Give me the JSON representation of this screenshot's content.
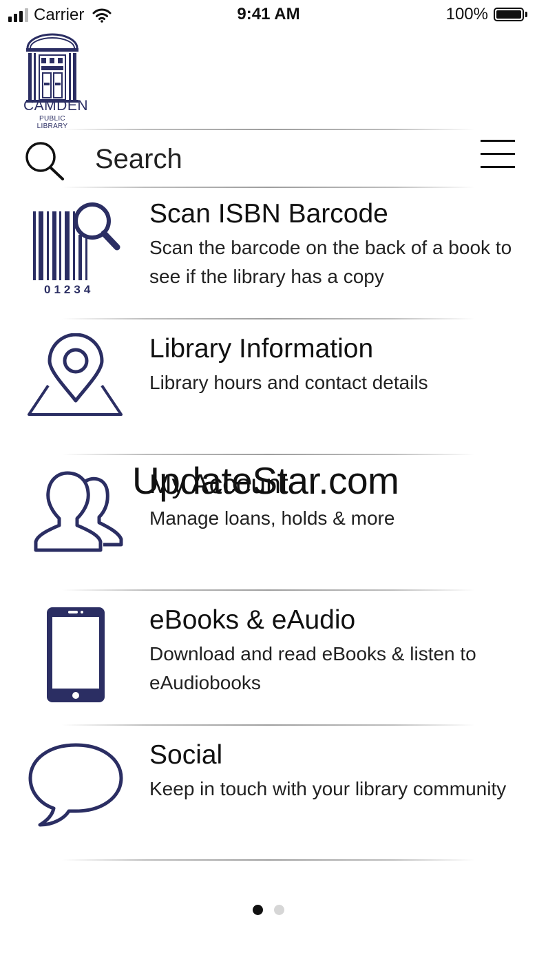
{
  "status_bar": {
    "carrier": "Carrier",
    "time": "9:41 AM",
    "battery": "100%"
  },
  "logo": {
    "name": "CAMDEN",
    "subtitle": "PUBLIC LIBRARY"
  },
  "search": {
    "placeholder": "Search"
  },
  "menu": {
    "items": [
      {
        "title": "Scan ISBN Barcode",
        "description": "Scan the barcode on the back of a book to see if the library has a copy",
        "icon": "barcode-scan-icon",
        "barcode_digits": "01234"
      },
      {
        "title": "Library Information",
        "description": "Library hours and contact details",
        "icon": "map-pin-icon"
      },
      {
        "title": "My Account",
        "description": "Manage loans, holds & more",
        "icon": "users-icon"
      },
      {
        "title": "eBooks & eAudio",
        "description": "Download and read eBooks & listen to eAudiobooks",
        "icon": "phone-icon"
      },
      {
        "title": "Social",
        "description": "Keep in touch with your library community",
        "icon": "speech-bubble-icon"
      }
    ]
  },
  "watermark": "UpdateStar.com",
  "pagination": {
    "current": 1,
    "total": 2
  },
  "colors": {
    "icon_navy": "#2b2e63",
    "text": "#111111",
    "dot_inactive": "#d6d6d6"
  }
}
